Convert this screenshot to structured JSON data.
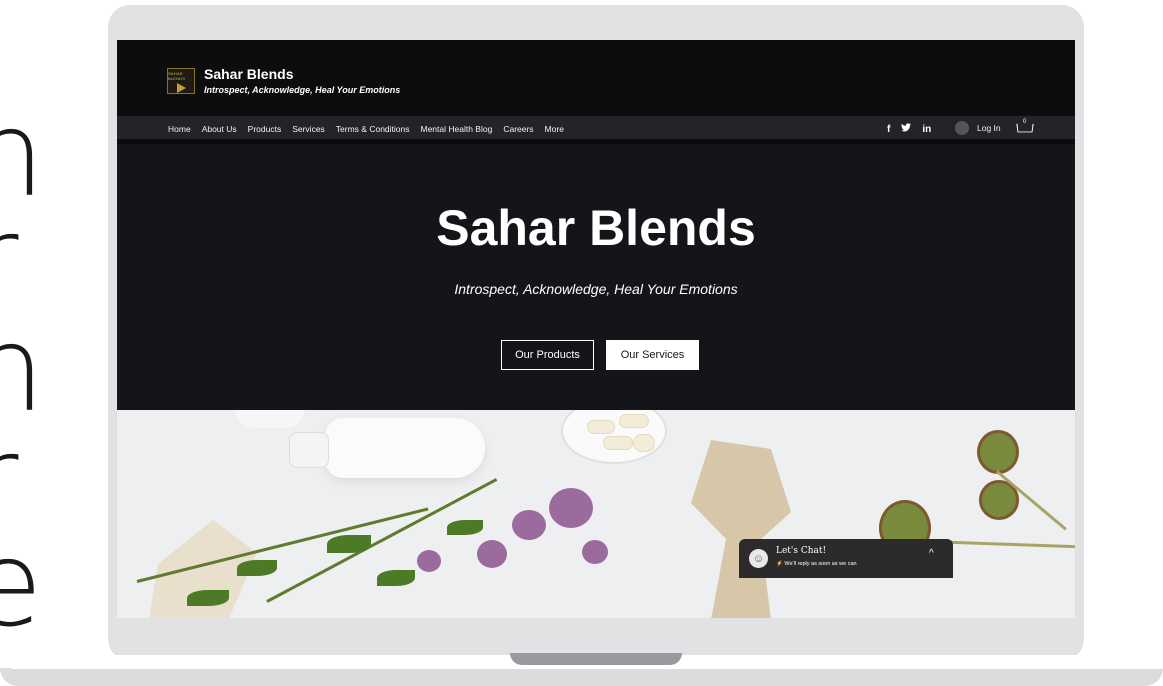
{
  "site": {
    "brand_name": "Sahar Blends",
    "tagline": "Introspect, Acknowledge, Heal Your Emotions",
    "logo_text": "SAHAR BLENDS"
  },
  "nav": {
    "items": [
      {
        "label": "Home"
      },
      {
        "label": "About Us"
      },
      {
        "label": "Products"
      },
      {
        "label": "Services"
      },
      {
        "label": "Terms & Conditions"
      },
      {
        "label": "Mental Health Blog"
      },
      {
        "label": "Careers"
      },
      {
        "label": "More"
      }
    ],
    "social": {
      "facebook": "f",
      "twitter": "🐦",
      "linkedin": "in"
    },
    "login_label": "Log In",
    "cart_count": "0"
  },
  "hero": {
    "title": "Sahar Blends",
    "subtitle": "Introspect, Acknowledge, Heal Your Emotions",
    "primary_button": "Our Products",
    "secondary_button": "Our Services"
  },
  "chat": {
    "title": "Let's Chat!",
    "note": "We'll reply as soon as we can",
    "chevron": "^"
  },
  "colors": {
    "header_bg": "#0d0d10",
    "hero_bg": "#151419",
    "nav_bg": "#24232a",
    "chat_bg": "#2d2a2b"
  }
}
